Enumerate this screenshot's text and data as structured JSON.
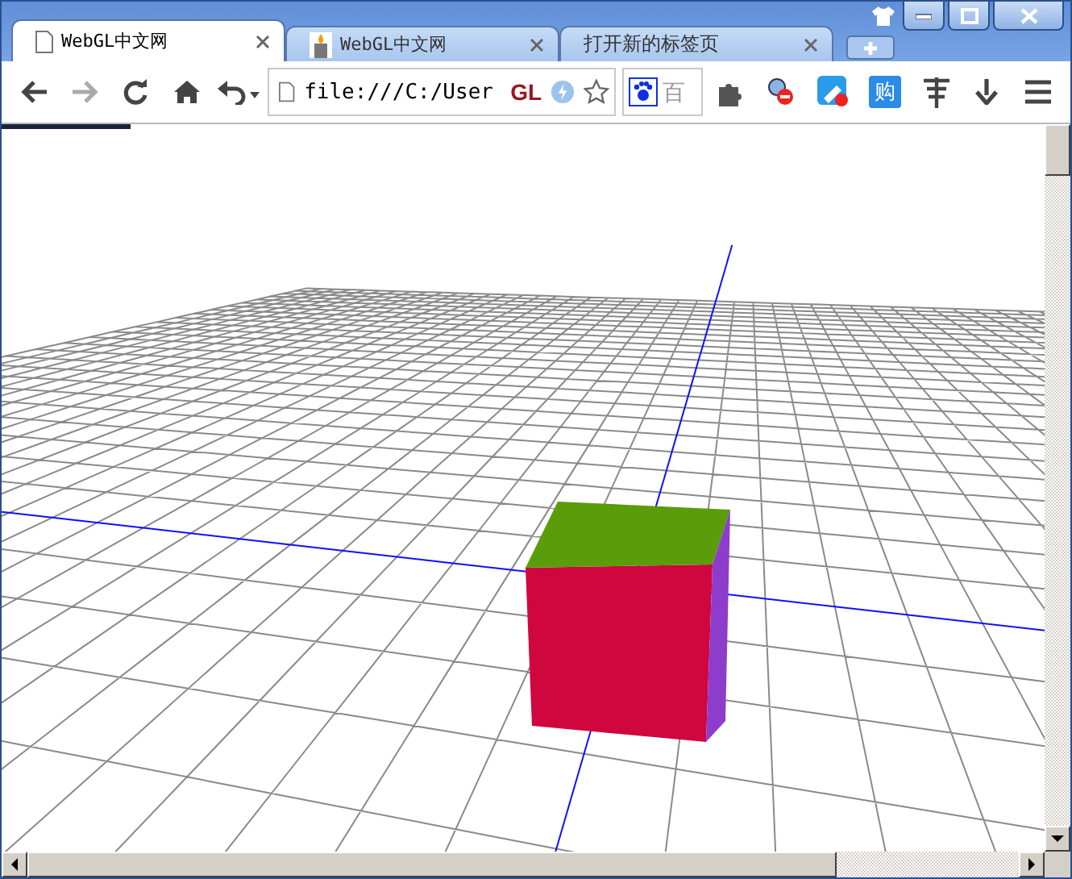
{
  "tabs": [
    {
      "title": "WebGL中文网",
      "kind": "page",
      "selected": true
    },
    {
      "title": "WebGL中文网",
      "kind": "favicon",
      "selected": false
    },
    {
      "title": "打开新的标签页",
      "kind": "none",
      "selected": false
    }
  ],
  "toolbar": {
    "back_disabled": false,
    "forward_disabled": true,
    "address": "file:///C:/User",
    "extension_badge": "GL",
    "search_placeholder": "百",
    "shop_badge": "购"
  }
}
